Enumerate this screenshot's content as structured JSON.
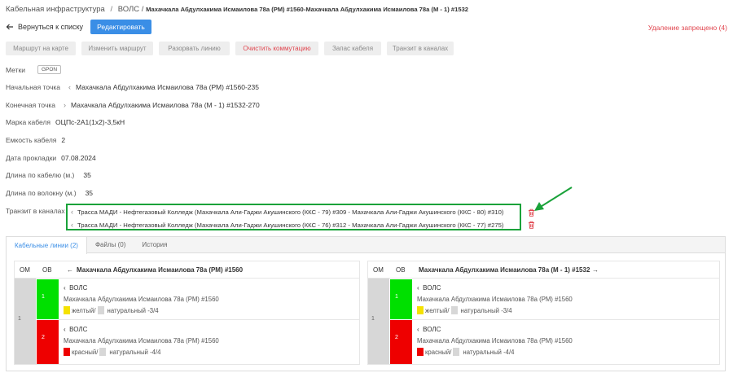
{
  "breadcrumb": {
    "root": "Кабельная инфраструктура",
    "sep": "/",
    "section": "ВОЛС /",
    "current": "Махачкала Абдулхакима Исмаилова 78а (РМ) #1560-Махачкала Абдулхакима Исмаилова 78а (М - 1) #1532"
  },
  "header": {
    "back_label": "Вернуться к списку",
    "edit_label": "Редактировать",
    "delete_forbidden": "Удаление запрещено (4)"
  },
  "toolbar": [
    "Маршрут на карте",
    "Изменить маршрут",
    "Разорвать линию",
    "Очистить коммутацию",
    "Запас кабеля",
    "Транзит в каналах"
  ],
  "colors": {
    "accent": "#3a8ee6",
    "danger": "#e0454e",
    "highlight": "#1aa23a",
    "green": "#00e000",
    "red": "#ee0000",
    "yellow": "#f5e200",
    "gray": "#d7d7d7"
  },
  "fields": {
    "tags_label": "Метки",
    "tag": "GPON",
    "start_label": "Начальная точка",
    "start_value": "Махачкала Абдулхакима Исмаилова 78а (РМ) #1560-235",
    "end_label": "Конечная точка",
    "end_value": "Махачкала Абдулхакима Исмаилова 78а (М - 1) #1532-270",
    "brand_label": "Марка кабеля",
    "brand_value": "ОЦПс-2А1(1х2)-3,5кН",
    "capacity_label": "Емкость кабеля",
    "capacity_value": "2",
    "date_label": "Дата прокладки",
    "date_value": "07.08.2024",
    "len_cable_label": "Длина по кабелю (м.)",
    "len_cable_value": "35",
    "len_fiber_label": "Длина по волокну (м.)",
    "len_fiber_value": "35",
    "transit_label": "Транзит в каналах",
    "transit": [
      "Трасса МАДИ - Нефтегазовый Колледж (Махачкала Али-Гаджи Акушинского (ККС - 79) #309 - Махачкала Али-Гаджи Акушинского (ККС - 80) #310)",
      "Трасса МАДИ - Нефтегазовый Колледж (Махачкала Али-Гаджи Акушинского (ККС - 76) #312 - Махачкала Али-Гаджи Акушинского (ККС - 77) #275)"
    ]
  },
  "tabs": [
    "Кабельные линии (2)",
    "Файлы (0)",
    "История"
  ],
  "left_panel": {
    "om": "ОМ",
    "ob": "ОВ",
    "title": "Махачкала Абдулхакима Исмаилова 78а (РМ) #1560",
    "om_num": "1",
    "fibers": [
      {
        "num": "1",
        "name": "ВОЛС",
        "loc": "Махачкала Абдулхакима Исмаилова 78а (РМ) #1560",
        "color_name": "желтый/",
        "sub": "натуральный -3/4"
      },
      {
        "num": "2",
        "name": "ВОЛС",
        "loc": "Махачкала Абдулхакима Исмаилова 78а (РМ) #1560",
        "color_name": "красный/",
        "sub": "натуральный -4/4"
      }
    ]
  },
  "right_panel": {
    "om": "ОМ",
    "ob": "ОВ",
    "title": "Махачкала Абдулхакима Исмаилова 78а (М - 1) #1532",
    "om_num": "1",
    "fibers": [
      {
        "num": "1",
        "name": "ВОЛС",
        "loc": "Махачкала Абдулхакима Исмаилова 78а (РМ) #1560",
        "color_name": "желтый/",
        "sub": "натуральный -3/4"
      },
      {
        "num": "2",
        "name": "ВОЛС",
        "loc": "Махачкала Абдулхакима Исмаилова 78а (РМ) #1560",
        "color_name": "красный/",
        "sub": "натуральный -4/4"
      }
    ]
  }
}
